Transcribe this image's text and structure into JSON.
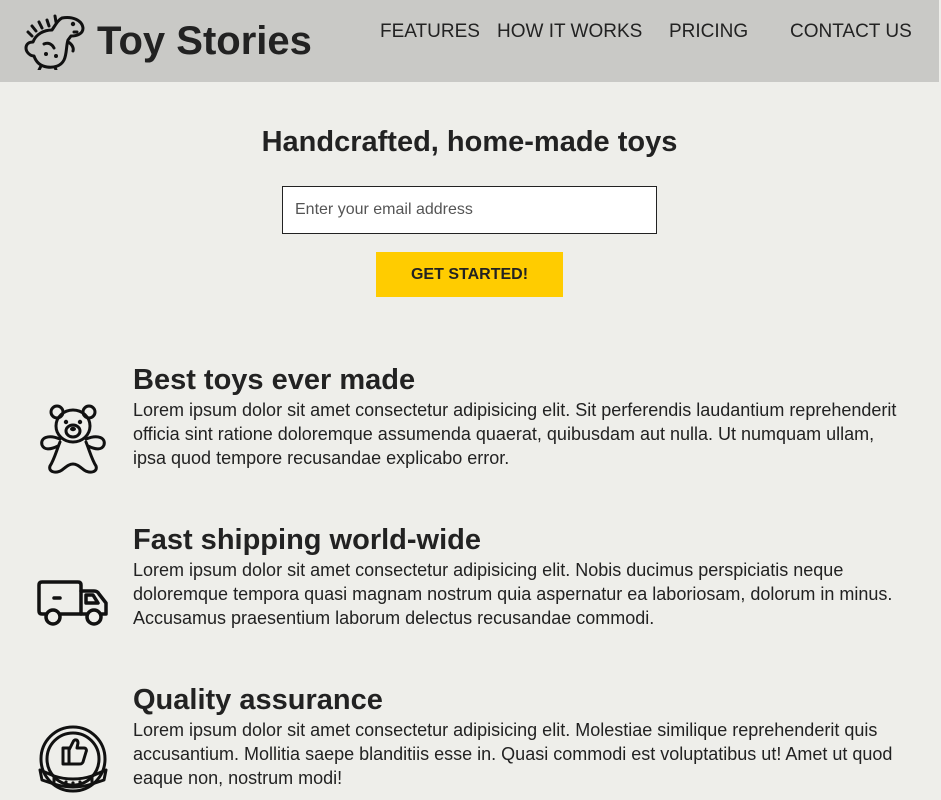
{
  "brand": {
    "name": "Toy Stories",
    "logo_icon": "dinosaur-icon"
  },
  "nav": {
    "items": [
      {
        "label": "FEATURES"
      },
      {
        "label": "HOW IT WORKS"
      },
      {
        "label": "PRICING"
      },
      {
        "label": "CONTACT US"
      }
    ]
  },
  "hero": {
    "title": "Handcrafted, home-made toys",
    "email_placeholder": "Enter your email address",
    "email_value": "",
    "cta_label": "GET STARTED!"
  },
  "features": [
    {
      "icon": "teddy-bear-icon",
      "title": "Best toys ever made",
      "text": "Lorem ipsum dolor sit amet consectetur adipisicing elit. Sit perferendis laudantium reprehenderit officia sint ratione doloremque assumenda quaerat, quibusdam aut nulla. Ut numquam ullam, ipsa quod tempore recusandae explicabo error."
    },
    {
      "icon": "delivery-truck-icon",
      "title": "Fast shipping world-wide",
      "text": "Lorem ipsum dolor sit amet consectetur adipisicing elit. Nobis ducimus perspiciatis neque doloremque tempora quasi magnam nostrum quia aspernatur ea laboriosam, dolorum in minus. Accusamus praesentium laborum delectus recusandae commodi."
    },
    {
      "icon": "quality-badge-icon",
      "title": "Quality assurance",
      "text": "Lorem ipsum dolor sit amet consectetur adipisicing elit. Molestiae similique reprehenderit quis accusantium. Mollitia saepe blanditiis esse in. Quasi commodi est voluptatibus ut! Amet ut quod eaque non, nostrum modi!"
    }
  ],
  "colors": {
    "header_bg": "#c9c9c6",
    "page_bg": "#eeeeea",
    "accent": "#ffcc00",
    "text": "#222222"
  }
}
